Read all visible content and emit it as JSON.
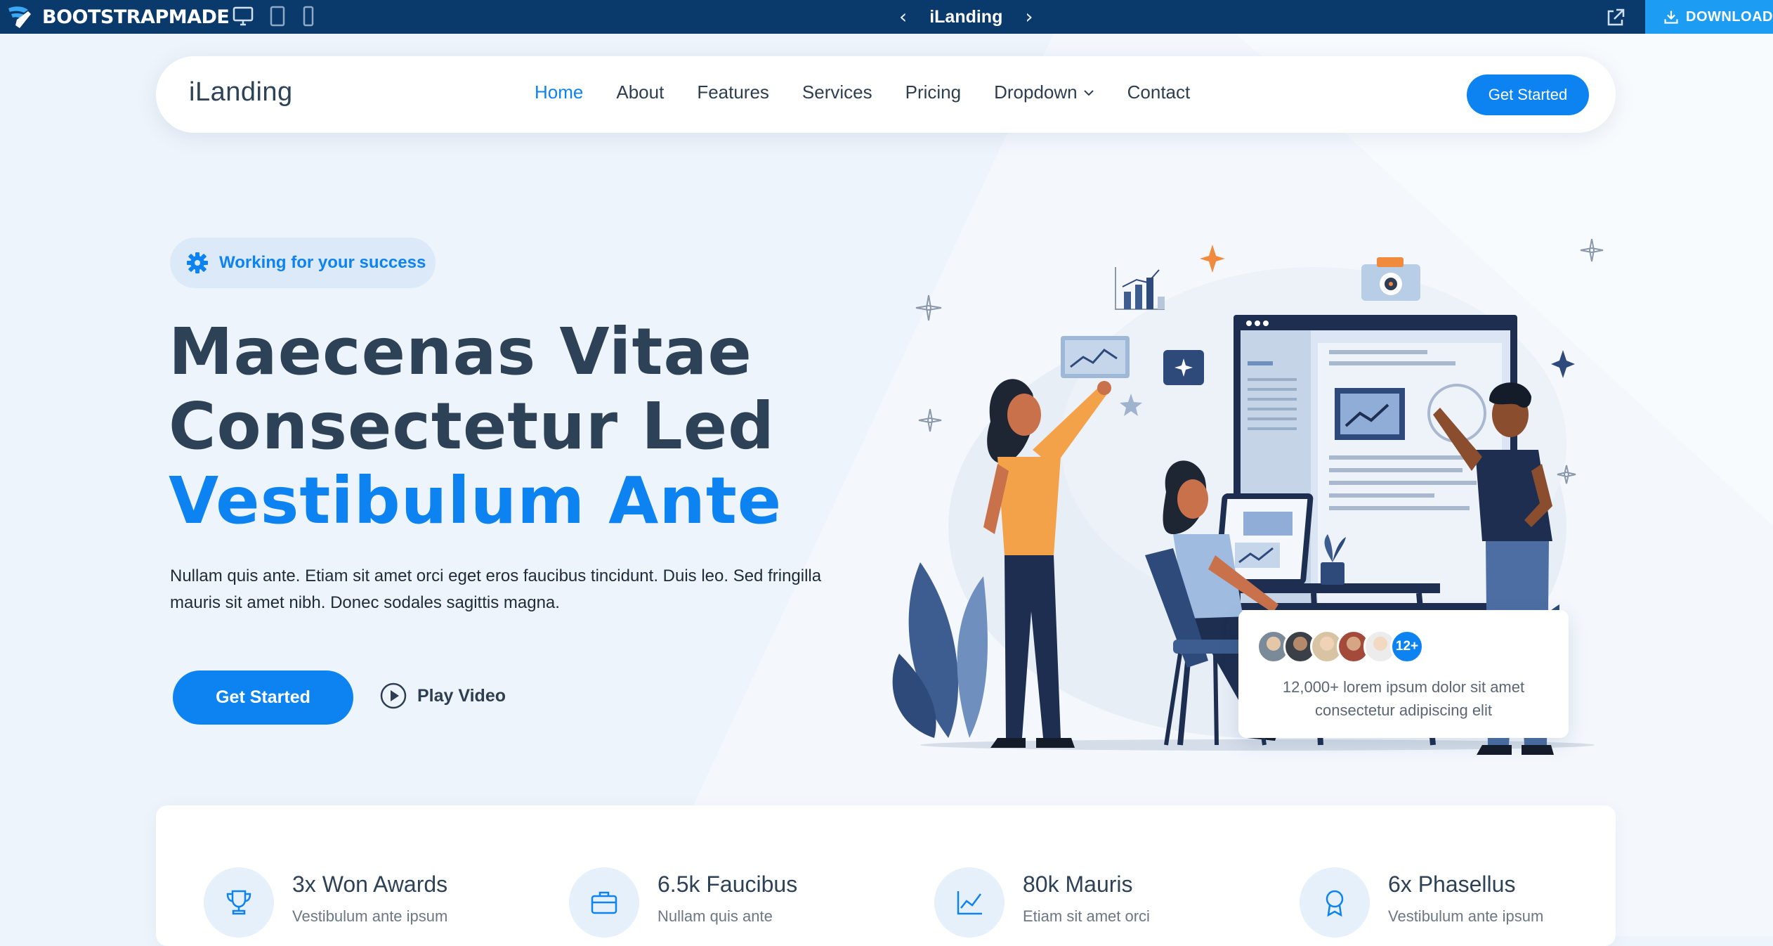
{
  "topbar": {
    "brand": "BOOTSTRAPMADE",
    "devices": [
      "desktop-icon",
      "tablet-icon",
      "mobile-icon"
    ],
    "title": "iLanding",
    "download_label": "DOWNLOAD",
    "background": "#0a3a6b",
    "download_color": "#1d9cf4"
  },
  "nav": {
    "logo": "iLanding",
    "items": [
      {
        "label": "Home",
        "active": true
      },
      {
        "label": "About"
      },
      {
        "label": "Features"
      },
      {
        "label": "Services"
      },
      {
        "label": "Pricing"
      },
      {
        "label": "Dropdown",
        "has_dropdown": true
      },
      {
        "label": "Contact"
      }
    ],
    "cta": "Get Started"
  },
  "hero": {
    "badge": "Working for your success",
    "title_line1": "Maecenas Vitae",
    "title_line2": "Consectetur Led",
    "title_line3": "Vestibulum Ante",
    "description_line1": "Nullam quis ante. Etiam sit amet orci eget eros faucibus tincidunt. Duis leo. Sed fringilla",
    "description_line2": "mauris sit amet nibh. Donec sodales sagittis magna.",
    "cta": "Get Started",
    "video_label": "Play Video"
  },
  "popup": {
    "more_count": "12+",
    "text_line1": "12,000+ lorem ipsum dolor sit amet",
    "text_line2": "consectetur adipiscing elit"
  },
  "stats": [
    {
      "icon": "trophy-icon",
      "title": "3x Won Awards",
      "subtitle": "Vestibulum ante ipsum"
    },
    {
      "icon": "briefcase-icon",
      "title": "6.5k Faucibus",
      "subtitle": "Nullam quis ante"
    },
    {
      "icon": "graph-up-icon",
      "title": "80k Mauris",
      "subtitle": "Etiam sit amet orci"
    },
    {
      "icon": "award-icon",
      "title": "6x Phasellus",
      "subtitle": "Vestibulum ante ipsum"
    }
  ],
  "colors": {
    "accent": "#0d83f2",
    "heading": "#2d4256",
    "page_bg": "#eef4fb"
  }
}
